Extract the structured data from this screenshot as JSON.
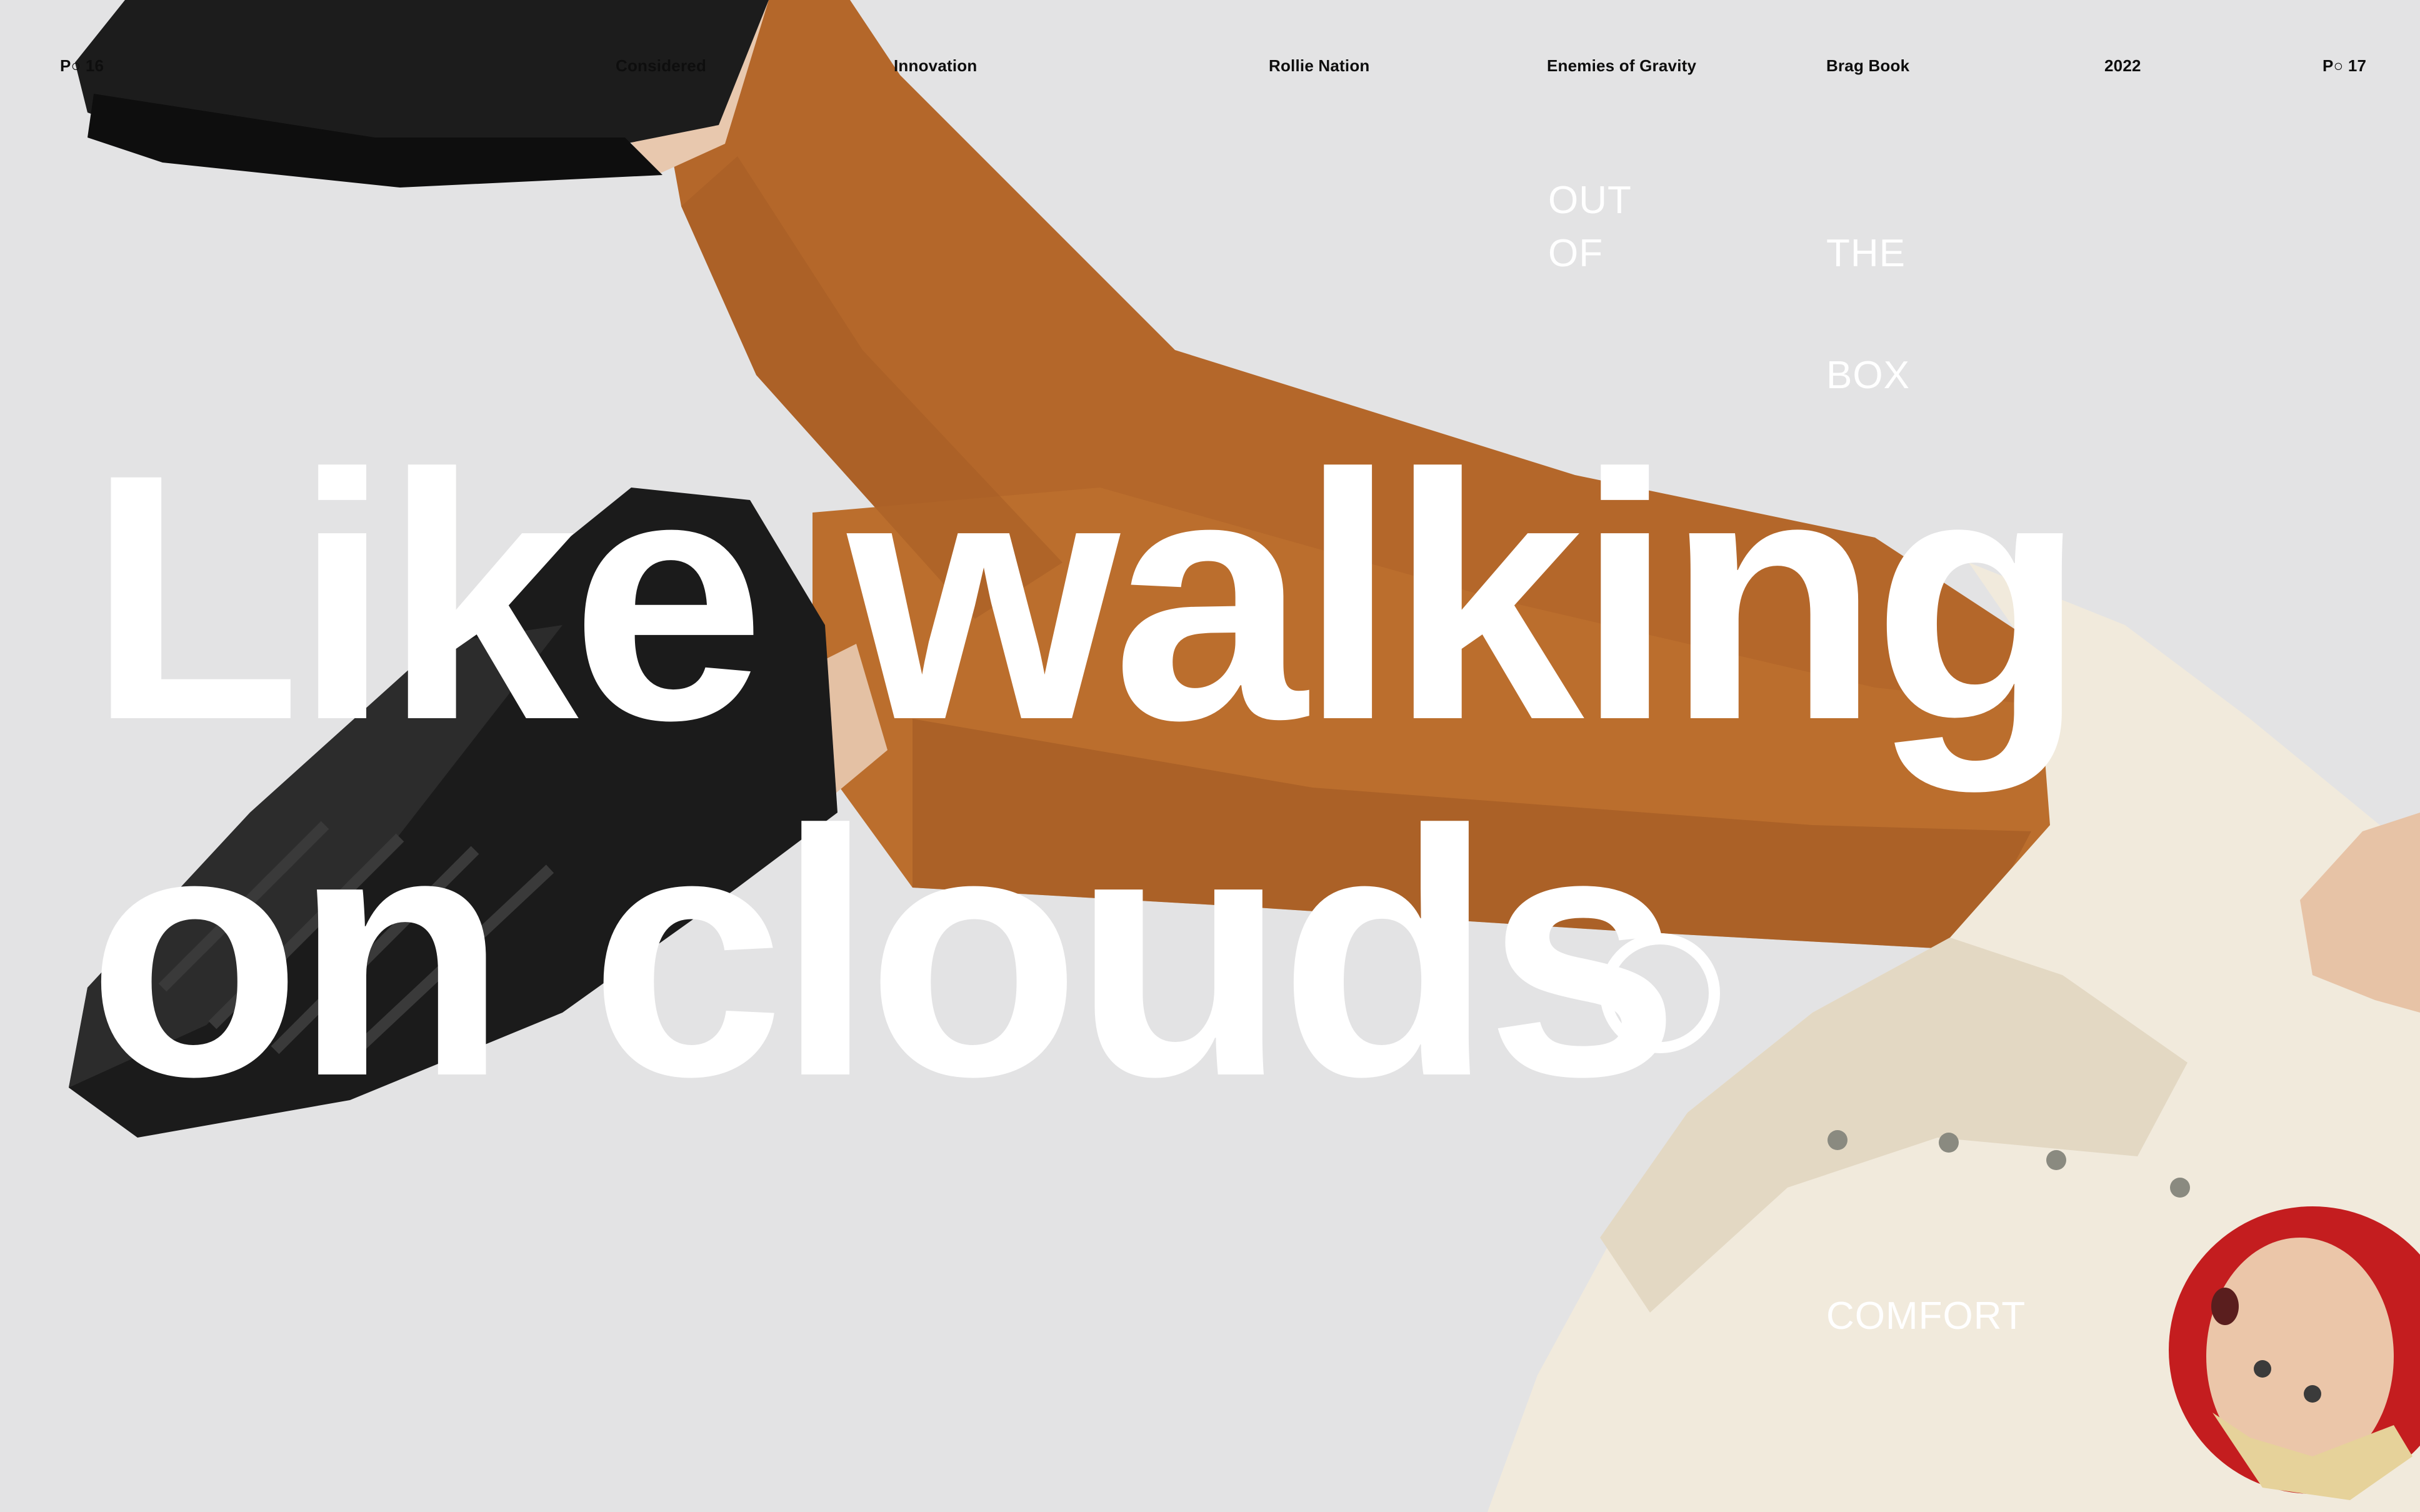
{
  "nav": {
    "page_left": "P○ 16",
    "items": [
      "Considered",
      "Innovation",
      "Rollie Nation",
      "Enemies of Gravity",
      "Brag Book",
      "2022"
    ],
    "page_right": "P○ 17"
  },
  "labels": {
    "out": "OUT",
    "of": "OF",
    "the": "THE",
    "box": "BOX",
    "comfort": "COMFORT"
  },
  "headline": {
    "line1": "Like walking",
    "line2": "on clouds"
  },
  "colors": {
    "background": "#e3e3e4",
    "text_light": "#ffffff",
    "text_dark": "#0d0d0d",
    "pants": "#b86a2a",
    "shirt": "#f2ebdd",
    "shoe": "#1a1a1a",
    "hat": "#c81e1e"
  }
}
